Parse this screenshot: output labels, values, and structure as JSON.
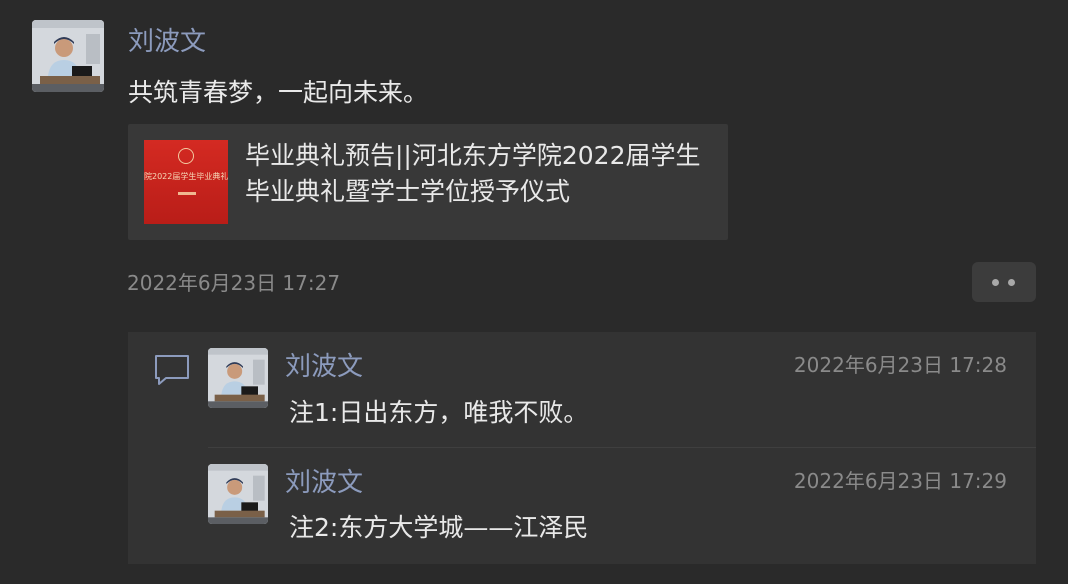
{
  "post": {
    "author": "刘波文",
    "text": "共筑青春梦，一起向未来。",
    "time": "2022年6月23日 17:27",
    "link": {
      "title": "毕业典礼预告||河北东方学院2022届学生毕业典礼暨学士学位授予仪式",
      "thumbnail_text": "院2022届学生毕业典礼暨学士学"
    }
  },
  "comments": [
    {
      "author": "刘波文",
      "time": "2022年6月23日 17:28",
      "text": "注1:日出东方，唯我不败。"
    },
    {
      "author": "刘波文",
      "time": "2022年6月23日 17:29",
      "text": "注2:东方大学城——江泽民"
    }
  ],
  "icons": {
    "more": "more-dots-icon",
    "comment": "comment-icon"
  },
  "colors": {
    "background": "#2a2a2a",
    "name": "#8c9bbd",
    "text": "#e9e9e9",
    "timestamp": "#8a8a8a",
    "panel": "#333333"
  }
}
